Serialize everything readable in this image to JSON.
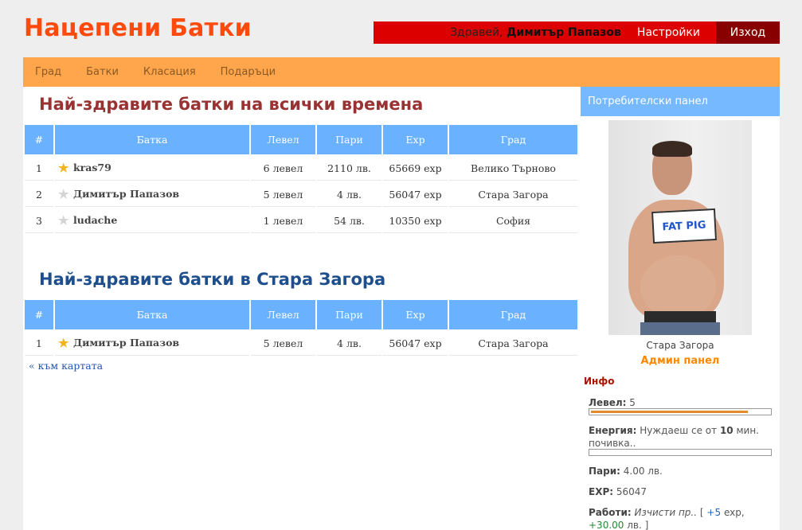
{
  "site": {
    "title": "Нацепени Батки"
  },
  "userbar": {
    "greeting": "Здравей,",
    "username": "Димитър Папазов",
    "settings": "Настройки",
    "logout": "Изход"
  },
  "nav": {
    "items": [
      "Град",
      "Батки",
      "Класация",
      "Подаръци"
    ]
  },
  "columns": {
    "num": "#",
    "name": "Батка",
    "level": "Левел",
    "money": "Пари",
    "exp": "Exp",
    "city": "Град"
  },
  "all_time": {
    "title": "Най-здравите батки на всички времена",
    "rows": [
      {
        "num": "1",
        "name": "kras79",
        "star": "gold",
        "level": "6 левел",
        "money": "2110 лв.",
        "exp": "65669 exp",
        "city": "Велико Търново"
      },
      {
        "num": "2",
        "name": "Димитър Папазов",
        "star": "grey",
        "level": "5 левел",
        "money": "4 лв.",
        "exp": "56047 exp",
        "city": "Стара Загора"
      },
      {
        "num": "3",
        "name": "ludache",
        "star": "grey",
        "level": "1 левел",
        "money": "54 лв.",
        "exp": "10350 exp",
        "city": "София"
      }
    ]
  },
  "city_top": {
    "title": "Най-здравите батки в Стара Загора",
    "rows": [
      {
        "num": "1",
        "name": "Димитър Папазов",
        "star": "gold",
        "level": "5 левел",
        "money": "4 лв.",
        "exp": "56047 exp",
        "city": "Стара Загора"
      }
    ]
  },
  "back_link": "« към картата",
  "sidebar": {
    "header": "Потребителски панел",
    "photo_sign": "FAT PIG",
    "city": "Стара Загора",
    "admin": "Админ панел",
    "info_title": "Инфо",
    "level_label": "Левел:",
    "level_value": "5",
    "level_progress": 0.88,
    "energy_label": "Енергия:",
    "energy_pre": "Нуждаеш се от",
    "energy_num": "10",
    "energy_post": "мин. почивка..",
    "energy_progress": 0,
    "money_label": "Пари:",
    "money_value": "4.00 лв.",
    "exp_label": "EXP:",
    "exp_value": "56047",
    "jobs_label": "Работи:",
    "jobs_task": "Изчисти пр..",
    "jobs_open": "[",
    "jobs_exp": "+5",
    "jobs_exp_unit": "exp,",
    "jobs_money": "+30.00",
    "jobs_money_unit": "лв. ]"
  },
  "colors": {
    "title": "#ff4a0d",
    "userbar": "#dd0000",
    "nav": "#ffa54b",
    "table_header": "#6ab2ff",
    "admin": "#ff8800"
  }
}
